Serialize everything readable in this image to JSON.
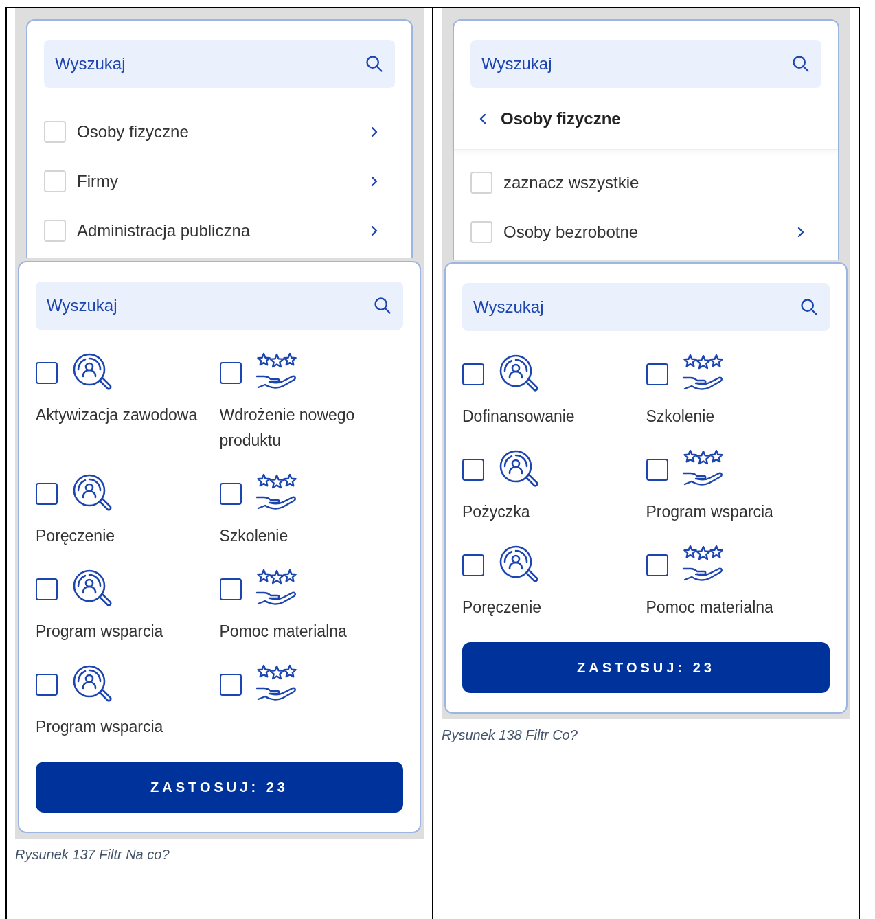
{
  "figures": [
    {
      "caption": "Rysunek 137 Filtr Na co?",
      "top_screen": {
        "search": {
          "placeholder": "Wyszukaj"
        },
        "items": [
          {
            "label": "Osoby fizyczne",
            "checked": false,
            "has_children": true
          },
          {
            "label": "Firmy",
            "checked": false,
            "has_children": true
          },
          {
            "label": "Administracja publiczna",
            "checked": false,
            "has_children": true
          }
        ]
      },
      "main_screen": {
        "search": {
          "placeholder": "Wyszukaj"
        },
        "options": [
          {
            "label": "Aktywizacja zawodowa",
            "kind": "search",
            "checked": false
          },
          {
            "label": "Wdrożenie nowego produktu",
            "kind": "stars",
            "checked": false
          },
          {
            "label": "Poręczenie",
            "kind": "search",
            "checked": false
          },
          {
            "label": "Szkolenie",
            "kind": "stars",
            "checked": false
          },
          {
            "label": "Program wsparcia",
            "kind": "search",
            "checked": false
          },
          {
            "label": "Pomoc materialna",
            "kind": "stars",
            "checked": false
          },
          {
            "label": "Program wsparcia",
            "kind": "search",
            "checked": false
          },
          {
            "kind": "stars",
            "checked": false
          }
        ],
        "apply_button": "ZASTOSUJ: 23"
      }
    },
    {
      "caption": "Rysunek 138 Filtr Co?",
      "top_screen": {
        "search": {
          "placeholder": "Wyszukaj"
        },
        "header": {
          "title": "Osoby fizyczne"
        },
        "items": [
          {
            "label": "zaznacz wszystkie",
            "checked": false,
            "has_children": false
          },
          {
            "label": "Osoby bezrobotne",
            "checked": false,
            "has_children": true
          }
        ]
      },
      "main_screen": {
        "search": {
          "placeholder": "Wyszukaj"
        },
        "options": [
          {
            "label": "Dofinansowanie",
            "kind": "search",
            "checked": false
          },
          {
            "label": "Szkolenie",
            "kind": "stars",
            "checked": false
          },
          {
            "label": "Pożyczka",
            "kind": "search",
            "checked": false
          },
          {
            "label": "Program wsparcia",
            "kind": "stars",
            "checked": false
          },
          {
            "label": "Poręczenie",
            "kind": "search",
            "checked": false
          },
          {
            "label": "Pomoc materialna",
            "kind": "stars",
            "checked": false
          }
        ],
        "apply_button": "ZASTOSUJ: 23"
      }
    }
  ]
}
